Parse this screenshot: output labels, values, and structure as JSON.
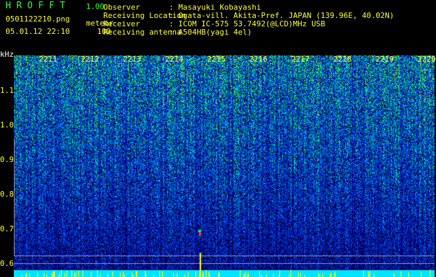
{
  "header": {
    "app_name": "H R O F F T",
    "version": "1.00",
    "filename": "0501122210.png",
    "datetime": "05.01.12 22:10",
    "mode_label": "meteor",
    "mode_value": "100"
  },
  "info": [
    {
      "label": "Observer",
      "value": ": Masayuki Kobayashi"
    },
    {
      "label": "Receiving Location",
      "value": ": Ogata-vill. Akita-Pref. JAPAN (139.96E, 40.02N)"
    },
    {
      "label": "Receiver",
      "value": ": ICOM IC-575 53.7492(@LCD)MHz USB"
    },
    {
      "label": "Receiving antenna",
      "value": ": A504HB(yagi 4el)"
    }
  ],
  "spectrogram": {
    "y_unit": "kHz",
    "y_ticks": [
      "1.1",
      "1.0",
      "0.9",
      "0.8",
      "0.7",
      "0.6"
    ],
    "time_ticks": [
      "2211",
      "2212",
      "2213",
      "2214",
      "2215",
      "2216",
      "2217",
      "2218",
      "2219",
      "2220"
    ],
    "colors": {
      "text": "#ffff33",
      "title": "#33ff33",
      "baseline": "#00e5ff"
    }
  }
}
